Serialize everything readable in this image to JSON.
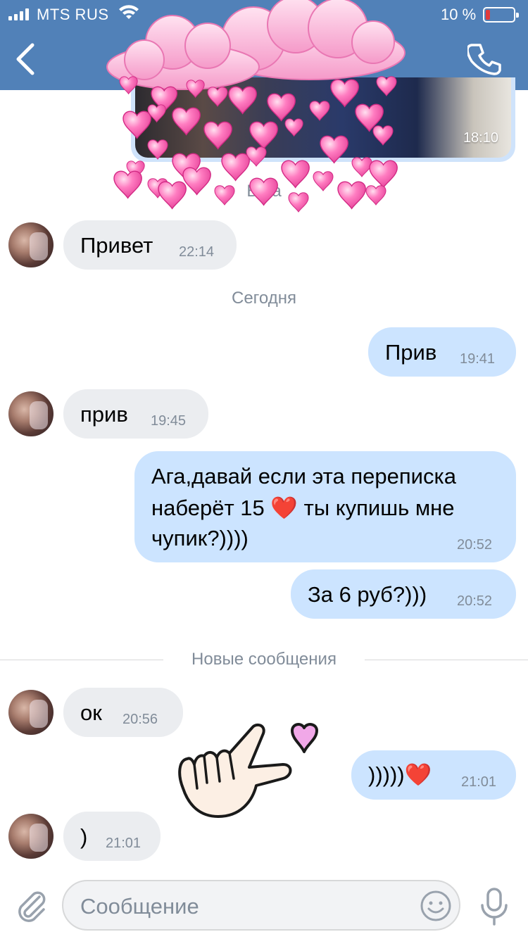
{
  "status_bar": {
    "carrier": "MTS RUS",
    "battery": "10 %",
    "battery_level": 0.1,
    "signal_bars": 4
  },
  "nav": {
    "back_icon": "chevron-left-icon",
    "call_icon": "phone-icon"
  },
  "media_preview": {
    "time": "18:10"
  },
  "date_labels": {
    "partial_obscured": "В   ра",
    "today": "Сегодня"
  },
  "messages": [
    {
      "dir": "in",
      "text": "Привет",
      "time": "22:14"
    },
    {
      "dir": "out",
      "text": "Прив",
      "time": "19:41"
    },
    {
      "dir": "in",
      "text": "прив",
      "time": "19:45"
    },
    {
      "dir": "out",
      "line1": "Ага,давай если эта переписка",
      "line2_a": "наберёт 15 ",
      "line2_emoji": "❤️",
      "line2_b": " ты купишь мне",
      "line3": "чупик?))))",
      "time": "20:52"
    },
    {
      "dir": "out",
      "text": "За 6 руб?)))",
      "time": "20:52"
    },
    {
      "dir": "in",
      "text": "ок",
      "time": "20:56"
    },
    {
      "dir": "out",
      "text": ")))))",
      "emoji": "❤️",
      "time": "21:01"
    },
    {
      "dir": "in",
      "text": ")",
      "time": "21:01"
    }
  ],
  "new_messages_label": "Новые сообщения",
  "composer": {
    "placeholder": "Сообщение",
    "attach_icon": "paperclip-icon",
    "emoji_icon": "smiley-icon",
    "mic_icon": "microphone-icon"
  },
  "colors": {
    "header": "#5181b8",
    "bubble_in": "#ebedf0",
    "bubble_out": "#cce4ff",
    "meta_text": "#818c99"
  }
}
